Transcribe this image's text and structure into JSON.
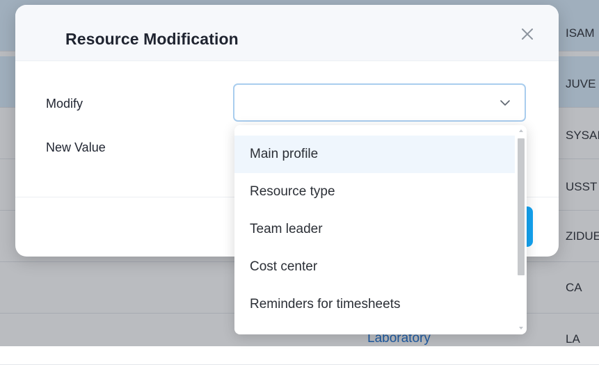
{
  "background_rows": [
    {
      "code": "ISAM",
      "selected": true
    },
    {
      "code": "JUVE",
      "selected": true
    },
    {
      "code": "SYSAI",
      "selected": false
    },
    {
      "code": "USST",
      "selected": false
    },
    {
      "code": "ZIDUE",
      "selected": false
    },
    {
      "code": "CA",
      "selected": false
    },
    {
      "code": "LA",
      "selected": false
    }
  ],
  "background_link": "Laboratory",
  "modal": {
    "title": "Resource Modification",
    "modify_label": "Modify",
    "new_value_label": "New Value",
    "modify_value": ""
  },
  "dropdown": {
    "options": [
      "Main profile",
      "Resource type",
      "Team leader",
      "Cost center",
      "Reminders for timesheets"
    ],
    "highlighted_index": 0
  },
  "colors": {
    "accent": "#14a3f0",
    "focus_border": "#a9cdee",
    "link": "#1a6fd1",
    "selected_row": "#d9ecfb"
  },
  "icons": {
    "close": "close-icon",
    "chevron": "chevron-down-icon"
  }
}
